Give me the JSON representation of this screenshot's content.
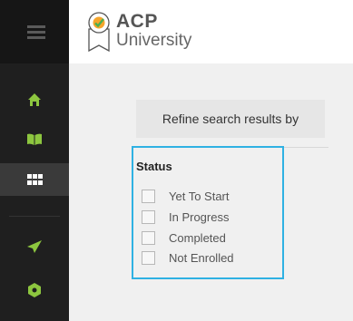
{
  "sidebar": {
    "items": [
      {
        "icon": "home-icon"
      },
      {
        "icon": "book-icon"
      },
      {
        "icon": "grid-icon"
      },
      {
        "icon": "send-icon"
      },
      {
        "icon": "hexagon-icon"
      }
    ],
    "icon_color": "#8dc63f",
    "active_index": 2
  },
  "header": {
    "logo_line1": "ACP",
    "logo_line2": "University"
  },
  "main": {
    "refine_label": "Refine search results by",
    "status": {
      "title": "Status",
      "options": [
        {
          "label": "Yet To Start",
          "checked": false
        },
        {
          "label": "In Progress",
          "checked": false
        },
        {
          "label": "Completed",
          "checked": false
        },
        {
          "label": "Not Enrolled",
          "checked": false
        }
      ]
    }
  }
}
